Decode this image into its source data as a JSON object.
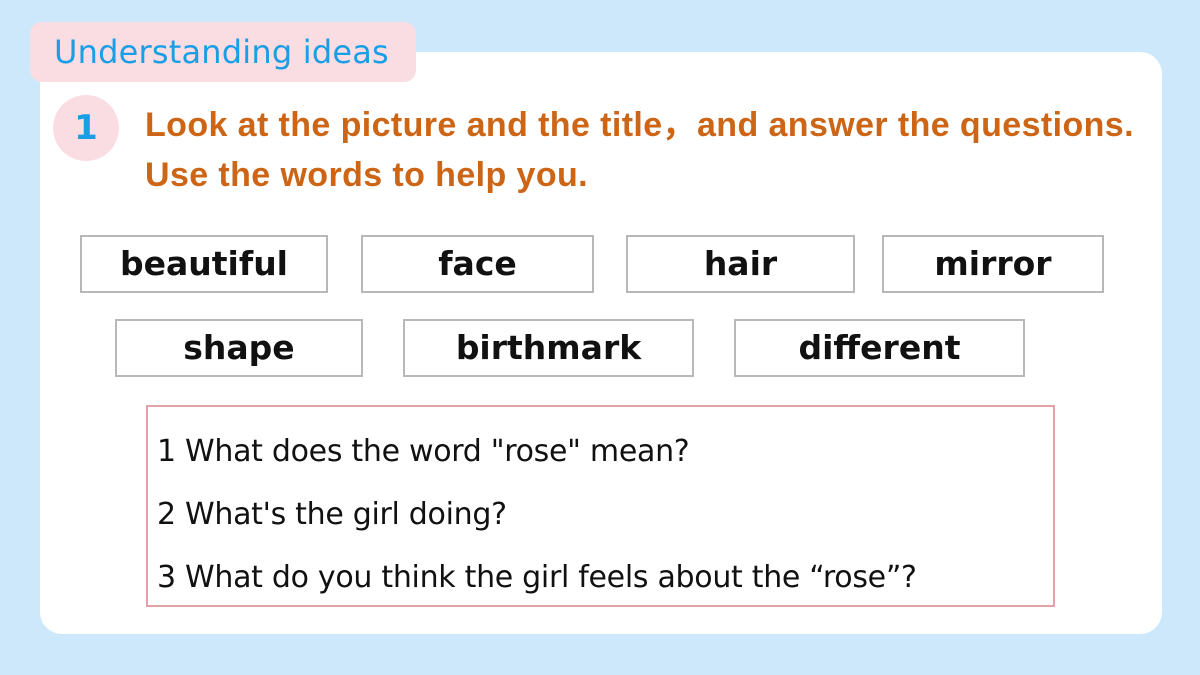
{
  "section": {
    "title": "Understanding ideas"
  },
  "exercise": {
    "number": "1",
    "instruction": "Look at the picture and the title，and answer the questions. Use the words to help you."
  },
  "word_bank": [
    "beautiful",
    "face",
    "hair",
    "mirror",
    "shape",
    "birthmark",
    "different"
  ],
  "questions": [
    "1 What does the word \"rose\" mean?",
    "2 What's the girl doing?",
    "3 What do you think the girl feels about the “rose”?"
  ],
  "colors": {
    "background": "#cde8fb",
    "tab_background": "#f9dde3",
    "tab_text": "#1a9ee6",
    "instruction_text": "#cd6517",
    "question_border": "#e3a0a8"
  }
}
